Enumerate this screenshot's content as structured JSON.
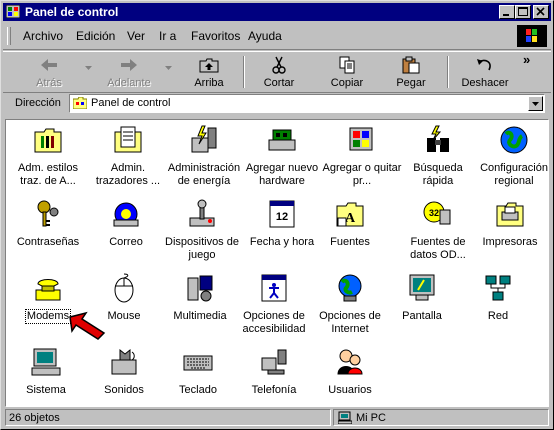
{
  "title": "Panel de control",
  "menu": [
    {
      "label": "Archivo",
      "key": "A"
    },
    {
      "label": "Edición",
      "key": "E"
    },
    {
      "label": "Ver",
      "key": "V"
    },
    {
      "label": "Ir a",
      "key": "I"
    },
    {
      "label": "Favoritos",
      "key": "F"
    },
    {
      "label": "Ayuda",
      "key": "y"
    }
  ],
  "toolbar": {
    "back": "Atrás",
    "forward": "Adelante",
    "up": "Arriba",
    "cut": "Cortar",
    "copy": "Copiar",
    "paste": "Pegar",
    "undo": "Deshacer",
    "more": "»"
  },
  "address": {
    "label": "Dirección",
    "value": "Panel de control"
  },
  "items": [
    {
      "label": "Adm. estilos traz. de A...",
      "icon": "fonts-folder-icon"
    },
    {
      "label": "Admin. trazadores ...",
      "icon": "folder-plotter-icon"
    },
    {
      "label": "Administración de energía",
      "icon": "power-management-icon"
    },
    {
      "label": "Agregar nuevo hardware",
      "icon": "add-hardware-icon"
    },
    {
      "label": "Agregar o quitar pr...",
      "icon": "add-remove-programs-icon"
    },
    {
      "label": "Búsqueda rápida",
      "icon": "binoculars-icon"
    },
    {
      "label": "Configuración regional",
      "icon": "globe-icon"
    },
    {
      "label": "Contraseñas",
      "icon": "keys-icon"
    },
    {
      "label": "Correo",
      "icon": "mail-icon"
    },
    {
      "label": "Dispositivos de juego",
      "icon": "joystick-icon"
    },
    {
      "label": "Fecha y hora",
      "icon": "calendar-clock-icon"
    },
    {
      "label": "Fuentes",
      "icon": "fonts-icon"
    },
    {
      "label": "Fuentes de datos OD...",
      "icon": "odbc-icon"
    },
    {
      "label": "Impresoras",
      "icon": "printer-icon"
    },
    {
      "label": "Modems",
      "icon": "modem-phone-icon"
    },
    {
      "label": "Mouse",
      "icon": "mouse-icon"
    },
    {
      "label": "Multimedia",
      "icon": "multimedia-icon"
    },
    {
      "label": "Opciones de accesibilidad",
      "icon": "accessibility-icon"
    },
    {
      "label": "Opciones de Internet",
      "icon": "internet-globe-icon"
    },
    {
      "label": "Pantalla",
      "icon": "display-monitor-icon"
    },
    {
      "label": "Red",
      "icon": "network-icon"
    },
    {
      "label": "Sistema",
      "icon": "computer-icon"
    },
    {
      "label": "Sonidos",
      "icon": "speaker-icon"
    },
    {
      "label": "Teclado",
      "icon": "keyboard-icon"
    },
    {
      "label": "Telefonía",
      "icon": "telephony-icon"
    },
    {
      "label": "Usuarios",
      "icon": "users-icon"
    }
  ],
  "status": {
    "count": "26 objetos",
    "location": "Mi PC"
  },
  "colors": {
    "titlebar": "#000080",
    "face": "#c0c0c0",
    "pointer": "#e00000"
  }
}
